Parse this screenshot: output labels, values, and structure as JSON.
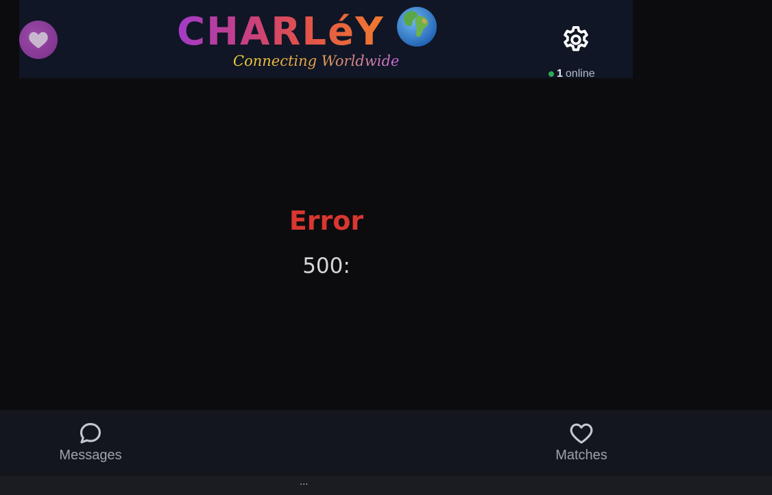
{
  "header": {
    "logo_title": "CHARLéY",
    "tagline": "Connecting Worldwide",
    "online_count": "1",
    "online_label": "online",
    "heart_icon": "heart-icon",
    "settings_icon": "gear-icon",
    "globe_icon": "globe-icon"
  },
  "error": {
    "title": "Error",
    "code": "500:"
  },
  "nav": {
    "messages_label": "Messages",
    "matches_label": "Matches"
  },
  "footer": {
    "ellipsis": "..."
  },
  "colors": {
    "background": "#0c0c0f",
    "header_bg": "#101625",
    "error_red": "#d8372f",
    "online_green": "#2eaa56",
    "nav_bg": "#14161d"
  }
}
